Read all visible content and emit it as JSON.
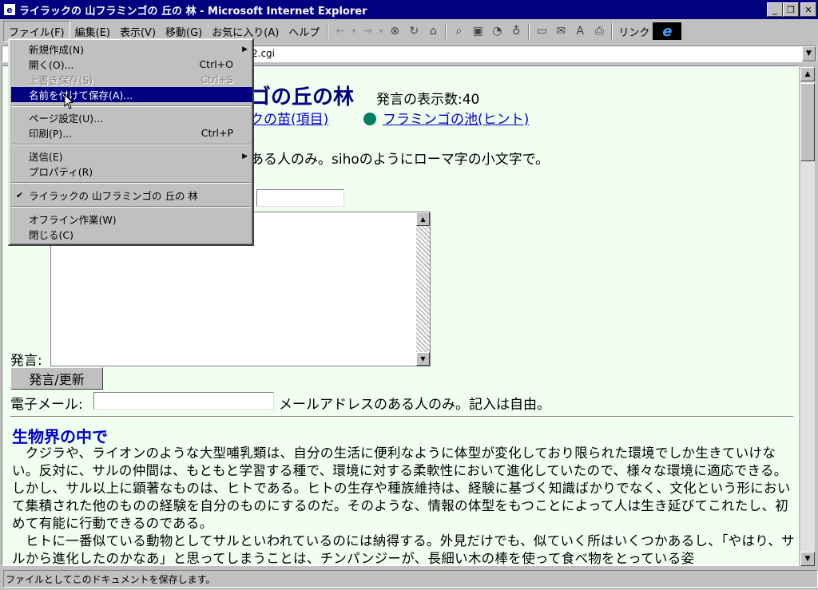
{
  "window": {
    "title": "ライラックの 山フラミンゴの 丘の 林 - Microsoft Internet Explorer",
    "minimize": "_",
    "restore": "❐",
    "close": "✕"
  },
  "menubar": {
    "items": [
      "ファイル(F)",
      "編集(E)",
      "表示(V)",
      "移動(G)",
      "お気に入り(A)",
      "ヘルプ"
    ],
    "link_label": "リンク"
  },
  "toolbar": {
    "back": "←",
    "forward": "→",
    "stop": "⊗",
    "refresh": "↻",
    "home": "⌂",
    "search": "⌕",
    "favorites": "▣",
    "history": "◔",
    "channels": "♁",
    "fullscreen": "▭",
    "mail": "✉",
    "font": "A",
    "print": "⎙",
    "dropdown": "▾"
  },
  "address": {
    "value": "2.cgi"
  },
  "file_menu": {
    "items": [
      {
        "label": "新規作成(N)",
        "shortcut": "",
        "arrow": "▶",
        "state": "normal"
      },
      {
        "label": "開く(O)...",
        "shortcut": "Ctrl+O",
        "arrow": "",
        "state": "normal"
      },
      {
        "label": "上書き保存(S)",
        "shortcut": "Ctrl+S",
        "arrow": "",
        "state": "disabled"
      },
      {
        "label": "名前を付けて保存(A)...",
        "shortcut": "",
        "arrow": "",
        "state": "selected"
      },
      {
        "label": "ページ設定(U)...",
        "shortcut": "",
        "arrow": "",
        "state": "normal"
      },
      {
        "label": "印刷(P)...",
        "shortcut": "Ctrl+P",
        "arrow": "",
        "state": "normal"
      },
      {
        "label": "送信(E)",
        "shortcut": "",
        "arrow": "▶",
        "state": "normal"
      },
      {
        "label": "プロパティ(R)",
        "shortcut": "",
        "arrow": "",
        "state": "normal"
      },
      {
        "label": "ライラックの 山フラミンゴの 丘の 林",
        "shortcut": "",
        "arrow": "",
        "state": "checked"
      },
      {
        "label": "オフライン作業(W)",
        "shortcut": "",
        "arrow": "",
        "state": "normal"
      },
      {
        "label": "閉じる(C)",
        "shortcut": "",
        "arrow": "",
        "state": "normal"
      }
    ],
    "check_mark": "✔"
  },
  "page": {
    "title_visible": "ゴの丘の林",
    "count_text": "発言の表示数:40",
    "link1": "クの苗(項目)",
    "link2": "フラミンゴの池(ヒント)",
    "note": "ある人のみ。sihoのようにローマ字の小文字で。",
    "speech_label": "発言:",
    "submit_label": "発言/更新",
    "email_label": "電子メール:",
    "email_note": "メールアドレスのある人のみ。記入は自由。",
    "section_title": "生物界の中で",
    "paragraphs": [
      "　クジラや、ライオンのような大型哺乳類は、自分の生活に便利なように体型が変化しており限られた環境でしか生きていけない。反対に、サルの仲間は、もともと学習する種で、環境に対する柔軟性において進化していたので、様々な環境に適応できる。しかし、サル以上に顕著なものは、ヒトである。ヒトの生存や種族維持は、経験に基づく知識ばかりでなく、文化という形において集積された他のものの経験を自分のものにするのだ。そのような、情報の体型をもつことによって人は生き延びてこれたし、初めて有能に行動できるのである。",
      "　ヒトに一番似ている動物としてサルといわれているのには納得する。外見だけでも、似ていく所はいくつかあるし、「やはり、サルから進化したのかなあ」と思ってしまうことは、チンパンジーが、長細い木の棒を使って食べ物をとっている姿"
    ]
  },
  "status": {
    "text": "ファイルとしてこのドキュメントを保存します。"
  }
}
